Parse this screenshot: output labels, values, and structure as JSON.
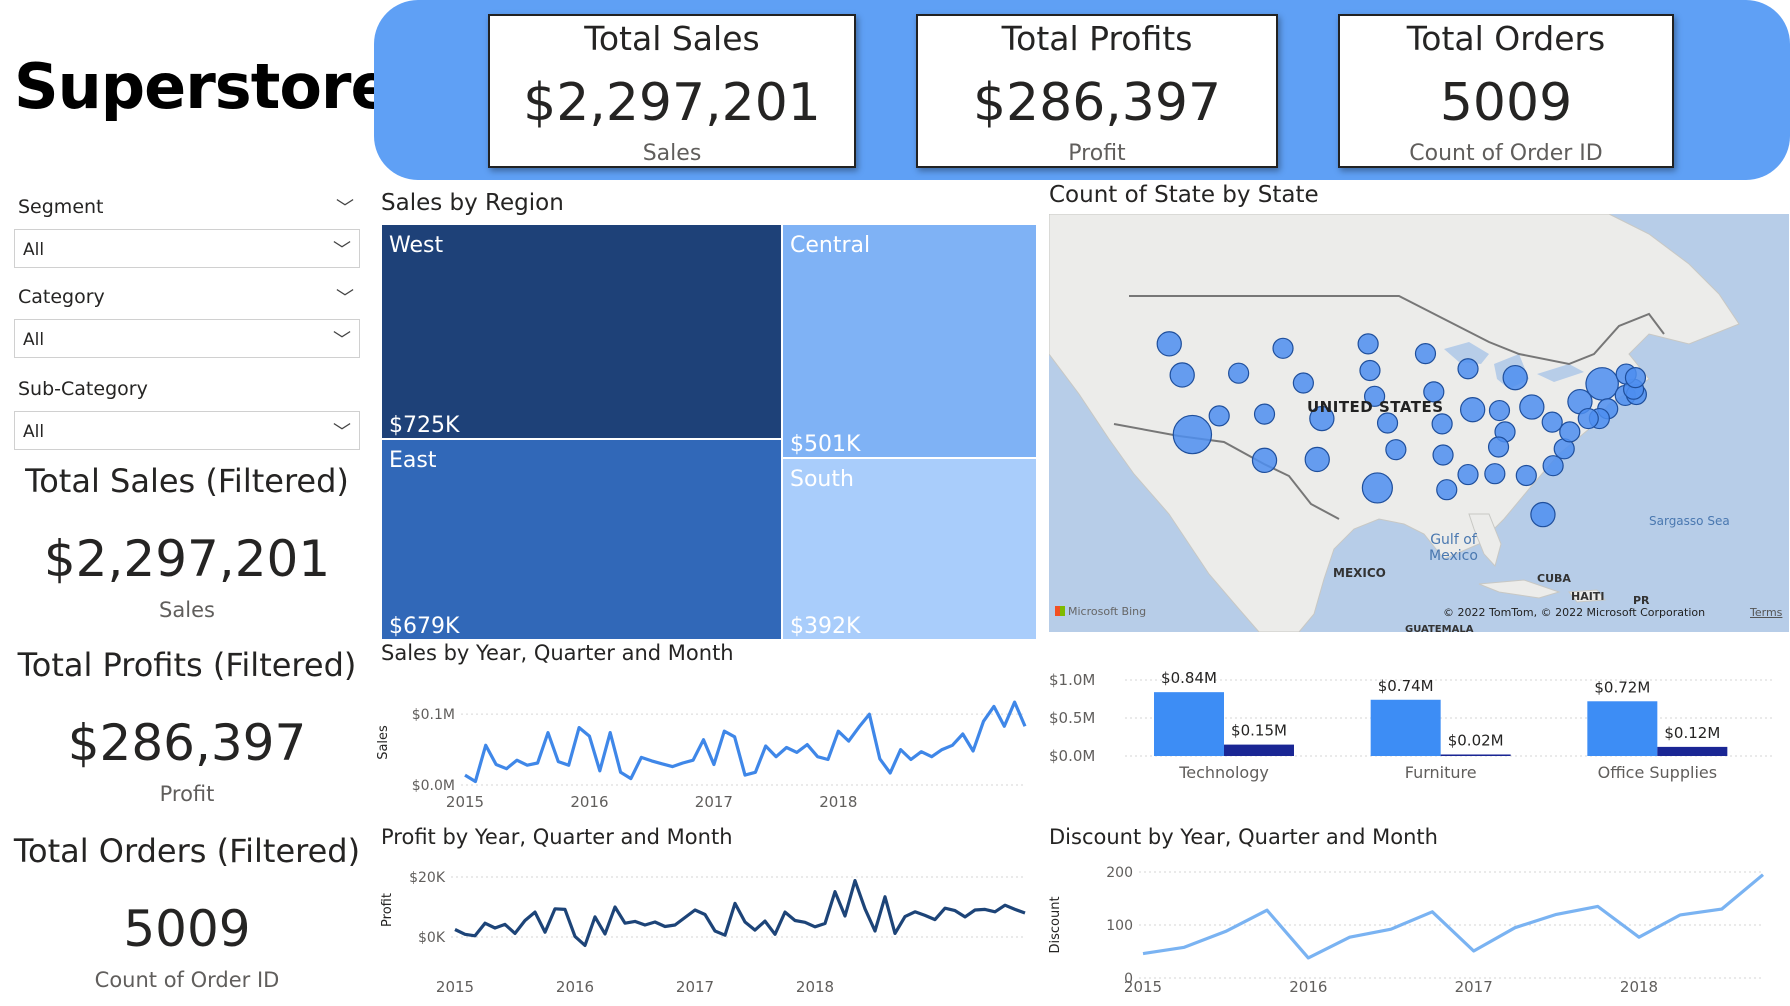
{
  "header": {
    "title": "Superstore"
  },
  "kpis": [
    {
      "title": "Total Sales",
      "value": "$2,297,201",
      "subtitle": "Sales"
    },
    {
      "title": "Total Profits",
      "value": "$286,397",
      "subtitle": "Profit"
    },
    {
      "title": "Total Orders",
      "value": "5009",
      "subtitle": "Count of Order ID"
    }
  ],
  "slicers": [
    {
      "title": "Segment",
      "value": "All"
    },
    {
      "title": "Category",
      "value": "All"
    },
    {
      "title": "Sub-Category",
      "value": "All"
    }
  ],
  "filtered": [
    {
      "title": "Total Sales (Filtered)",
      "value": "$2,297,201",
      "subtitle": "Sales"
    },
    {
      "title": "Total Profits (Filtered)",
      "value": "$286,397",
      "subtitle": "Profit"
    },
    {
      "title": "Total Orders (Filtered)",
      "value": "5009",
      "subtitle": "Count of Order ID"
    }
  ],
  "colors": {
    "banner": "#5fa0f5",
    "west": "#1e4178",
    "east": "#3168b8",
    "central": "#7fb2f5",
    "south": "#a9cdfb",
    "sales_line": "#3f87e8",
    "profit_line": "#1d4478",
    "discount_line": "#7ab3f2",
    "bar_sales": "#3d8df5",
    "bar_profit": "#1a2694",
    "map_land": "#ececea",
    "map_water": "#b7cde8",
    "bubble": "#4d8ef0"
  },
  "map": {
    "title": "Count of State by State",
    "labels": {
      "country": "UNITED STATES",
      "mexico": "MEXICO",
      "gulf_line1": "Gulf of",
      "gulf_line2": "Mexico",
      "sargasso": "Sargasso Sea",
      "cuba": "CUBA",
      "haiti": "HAITI",
      "pr": "PR",
      "guatemala": "GUATEMALA"
    },
    "attribution": "© 2022 TomTom, © 2022 Microsoft Corporation",
    "terms": "Terms",
    "brand": "Microsoft Bing",
    "bubbles": [
      {
        "lon": -122.0,
        "lat": 47.4,
        "count": 2
      },
      {
        "lon": -120.6,
        "lat": 43.9,
        "count": 2
      },
      {
        "lon": -119.5,
        "lat": 37.2,
        "count": 8
      },
      {
        "lon": -116.6,
        "lat": 39.3,
        "count": 1
      },
      {
        "lon": -114.5,
        "lat": 44.1,
        "count": 1
      },
      {
        "lon": -111.7,
        "lat": 39.5,
        "count": 1
      },
      {
        "lon": -111.7,
        "lat": 34.3,
        "count": 2
      },
      {
        "lon": -109.7,
        "lat": 46.9,
        "count": 1
      },
      {
        "lon": -107.5,
        "lat": 43.0,
        "count": 1
      },
      {
        "lon": -105.5,
        "lat": 39.0,
        "count": 2
      },
      {
        "lon": -106.0,
        "lat": 34.4,
        "count": 2
      },
      {
        "lon": -100.5,
        "lat": 47.4,
        "count": 1
      },
      {
        "lon": -100.3,
        "lat": 44.4,
        "count": 1
      },
      {
        "lon": -99.8,
        "lat": 41.5,
        "count": 1
      },
      {
        "lon": -98.4,
        "lat": 38.5,
        "count": 1
      },
      {
        "lon": -97.5,
        "lat": 35.5,
        "count": 1
      },
      {
        "lon": -99.5,
        "lat": 31.2,
        "count": 4
      },
      {
        "lon": -94.3,
        "lat": 46.3,
        "count": 1
      },
      {
        "lon": -93.4,
        "lat": 42.0,
        "count": 1
      },
      {
        "lon": -92.5,
        "lat": 38.4,
        "count": 1
      },
      {
        "lon": -92.4,
        "lat": 34.9,
        "count": 1
      },
      {
        "lon": -92.0,
        "lat": 31.0,
        "count": 1
      },
      {
        "lon": -89.7,
        "lat": 44.6,
        "count": 1
      },
      {
        "lon": -89.2,
        "lat": 40.0,
        "count": 2
      },
      {
        "lon": -89.7,
        "lat": 32.7,
        "count": 1
      },
      {
        "lon": -86.3,
        "lat": 39.9,
        "count": 1
      },
      {
        "lon": -84.6,
        "lat": 43.6,
        "count": 2
      },
      {
        "lon": -82.8,
        "lat": 40.3,
        "count": 2
      },
      {
        "lon": -85.7,
        "lat": 37.5,
        "count": 1
      },
      {
        "lon": -86.4,
        "lat": 35.8,
        "count": 1
      },
      {
        "lon": -86.8,
        "lat": 32.8,
        "count": 1
      },
      {
        "lon": -83.4,
        "lat": 32.6,
        "count": 1
      },
      {
        "lon": -81.6,
        "lat": 28.2,
        "count": 2
      },
      {
        "lon": -80.5,
        "lat": 33.7,
        "count": 1
      },
      {
        "lon": -79.3,
        "lat": 35.6,
        "count": 1
      },
      {
        "lon": -78.7,
        "lat": 37.5,
        "count": 1
      },
      {
        "lon": -80.6,
        "lat": 38.6,
        "count": 1
      },
      {
        "lon": -77.6,
        "lat": 40.9,
        "count": 2
      },
      {
        "lon": -75.2,
        "lat": 42.9,
        "count": 5
      },
      {
        "lon": -74.6,
        "lat": 40.1,
        "count": 1
      },
      {
        "lon": -75.5,
        "lat": 39.0,
        "count": 1
      },
      {
        "lon": -76.7,
        "lat": 39.0,
        "count": 1
      },
      {
        "lon": -72.7,
        "lat": 41.6,
        "count": 1
      },
      {
        "lon": -71.5,
        "lat": 41.7,
        "count": 1
      },
      {
        "lon": -71.8,
        "lat": 42.3,
        "count": 1
      },
      {
        "lon": -72.6,
        "lat": 44.0,
        "count": 1
      },
      {
        "lon": -71.6,
        "lat": 43.6,
        "count": 1
      }
    ]
  },
  "chart_data": [
    {
      "type": "treemap",
      "title": "Sales by Region",
      "items": [
        {
          "name": "West",
          "label": "$725K",
          "value": 725
        },
        {
          "name": "East",
          "label": "$679K",
          "value": 679
        },
        {
          "name": "Central",
          "label": "$501K",
          "value": 501
        },
        {
          "name": "South",
          "label": "$392K",
          "value": 392
        }
      ]
    },
    {
      "type": "line",
      "title": "Sales by Year, Quarter and Month",
      "ylabel": "Sales",
      "ylim": [
        0,
        0.12
      ],
      "y_ticks": [
        "$0.0M",
        "$0.1M"
      ],
      "y_tick_values": [
        0,
        0.1
      ],
      "x_ticks": [
        "2015",
        "2016",
        "2017",
        "2018"
      ],
      "x_tick_index": [
        0,
        12,
        24,
        36
      ],
      "values": [
        0.014,
        0.005,
        0.056,
        0.029,
        0.023,
        0.035,
        0.028,
        0.031,
        0.074,
        0.033,
        0.028,
        0.081,
        0.069,
        0.02,
        0.074,
        0.018,
        0.009,
        0.039,
        0.034,
        0.03,
        0.026,
        0.031,
        0.035,
        0.064,
        0.029,
        0.076,
        0.068,
        0.014,
        0.018,
        0.055,
        0.04,
        0.053,
        0.046,
        0.057,
        0.04,
        0.036,
        0.076,
        0.062,
        0.082,
        0.1,
        0.037,
        0.017,
        0.05,
        0.036,
        0.047,
        0.04,
        0.05,
        0.056,
        0.072,
        0.048,
        0.09,
        0.111,
        0.083,
        0.117,
        0.083
      ]
    },
    {
      "type": "line",
      "title": "Profit by Year, Quarter and Month",
      "ylabel": "Profit",
      "ylim": [
        -3000,
        21000
      ],
      "y_ticks": [
        "$0K",
        "$20K"
      ],
      "y_tick_values": [
        0,
        20000
      ],
      "x_ticks": [
        "2015",
        "2016",
        "2017",
        "2018"
      ],
      "x_tick_index": [
        0,
        12,
        24,
        36
      ],
      "values": [
        2500,
        900,
        400,
        4600,
        3000,
        4200,
        1200,
        5500,
        8300,
        1600,
        9400,
        9200,
        200,
        -2800,
        6700,
        1000,
        10000,
        4600,
        5200,
        4000,
        5000,
        3500,
        4000,
        6500,
        9000,
        7500,
        2000,
        600,
        11200,
        5000,
        2300,
        5300,
        900,
        8300,
        5500,
        4900,
        3400,
        4500,
        15100,
        7000,
        18800,
        9400,
        2000,
        13400,
        1200,
        6800,
        8400,
        7200,
        5800,
        9600,
        8800,
        6700,
        9000,
        9200,
        8400,
        10600,
        9200,
        8000
      ]
    },
    {
      "type": "bar",
      "title": "",
      "categories": [
        "Technology",
        "Furniture",
        "Office Supplies"
      ],
      "series": [
        {
          "values": [
            0.84,
            0.74,
            0.72
          ],
          "labels": [
            "$0.84M",
            "$0.74M",
            "$0.72M"
          ]
        },
        {
          "values": [
            0.15,
            0.02,
            0.12
          ],
          "labels": [
            "$0.15M",
            "$0.02M",
            "$0.12M"
          ]
        }
      ],
      "ylim": [
        0,
        1.0
      ],
      "y_ticks": [
        "$0.0M",
        "$0.5M",
        "$1.0M"
      ],
      "y_tick_values": [
        0,
        0.5,
        1.0
      ]
    },
    {
      "type": "line",
      "title": "Discount by Year, Quarter and Month",
      "ylabel": "Discount",
      "ylim": [
        0,
        200
      ],
      "y_ticks": [
        "0",
        "100",
        "200"
      ],
      "y_tick_values": [
        0,
        100,
        200
      ],
      "x_ticks": [
        "2015",
        "2016",
        "2017",
        "2018"
      ],
      "x_tick_index": [
        0,
        4,
        8,
        12
      ],
      "values": [
        46,
        58,
        88,
        128,
        38,
        77,
        92,
        125,
        51,
        95,
        120,
        135,
        77,
        119,
        130,
        195
      ]
    }
  ]
}
